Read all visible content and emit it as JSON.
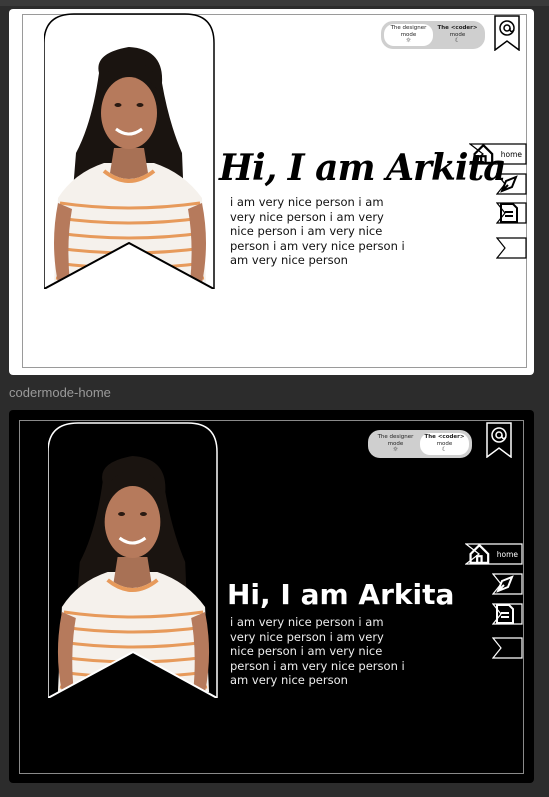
{
  "frames": {
    "designer": {
      "headline": "Hi, I am Arkita",
      "bio": "i am very nice person i am very nice person i am very nice person i am very nice person i am very nice person i am very nice person",
      "toggle": {
        "designer_line1": "The designer",
        "designer_line2": "mode",
        "coder_line1": "The <coder>",
        "coder_line2": "mode"
      },
      "nav": {
        "home_label": "home"
      },
      "colors": {
        "background": "#ffffff",
        "text": "#000000"
      }
    },
    "coder": {
      "label": "codermode-home",
      "headline": "Hi, I am Arkita",
      "bio": "i am very nice person i am very nice person i am very nice person i am very nice person i am very nice person i am very nice person",
      "toggle": {
        "designer_line1": "The designer",
        "designer_line2": "mode",
        "coder_line1": "The <coder>",
        "coder_line2": "mode"
      },
      "nav": {
        "home_label": "home"
      },
      "colors": {
        "background": "#000000",
        "text": "#ffffff"
      }
    }
  },
  "icons": {
    "contact": "at-sign-icon",
    "home": "home-icon",
    "design": "pen-tool-icon",
    "document": "document-icon",
    "designer_mode": "sun-icon",
    "coder_mode": "moon-icon"
  }
}
